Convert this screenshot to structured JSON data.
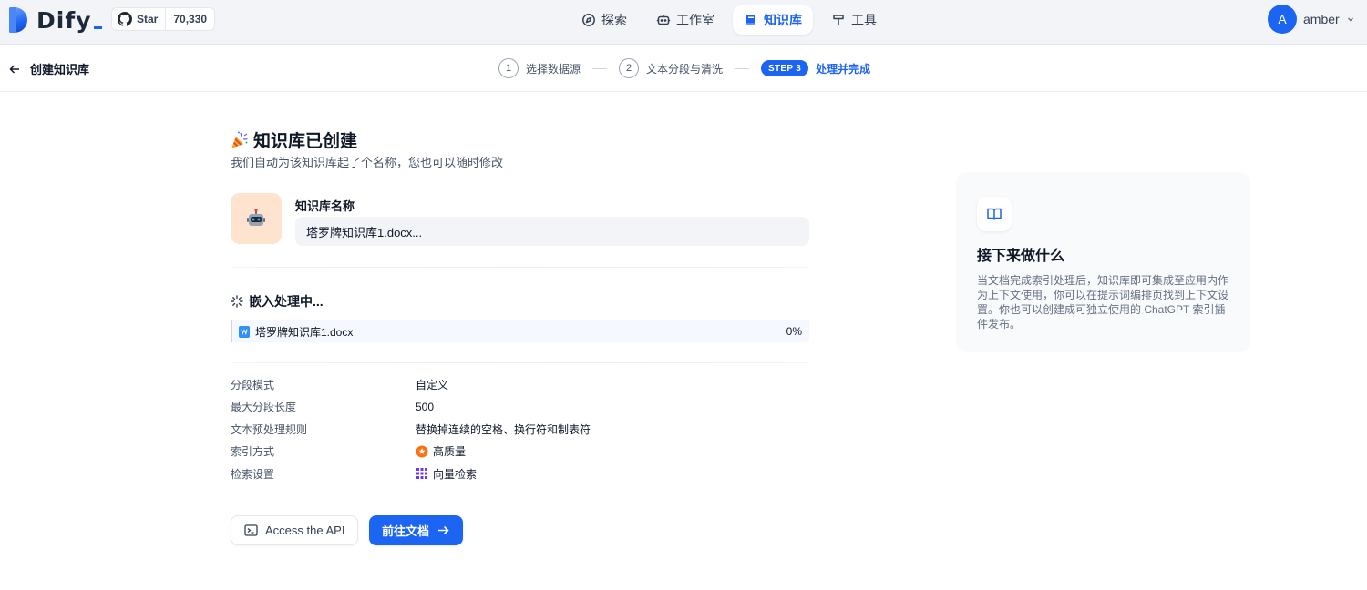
{
  "app": {
    "logo_text": "Dify"
  },
  "github": {
    "star_label": "Star",
    "star_count": "70,330"
  },
  "nav": {
    "items": [
      {
        "label": "探索",
        "icon": "compass-icon",
        "active": false
      },
      {
        "label": "工作室",
        "icon": "robot-icon",
        "active": false
      },
      {
        "label": "知识库",
        "icon": "book-icon",
        "active": true
      },
      {
        "label": "工具",
        "icon": "hammer-icon",
        "active": false
      }
    ]
  },
  "user": {
    "initial": "A",
    "name": "amber"
  },
  "subheader": {
    "back_label": "创建知识库",
    "steps": [
      {
        "num": "1",
        "label": "选择数据源"
      },
      {
        "num": "2",
        "label": "文本分段与清洗"
      },
      {
        "num": "STEP 3",
        "label": "处理并完成"
      }
    ]
  },
  "main": {
    "title": "知识库已创建",
    "subtitle": "我们自动为该知识库起了个名称，您也可以随时修改",
    "kb_name_label": "知识库名称",
    "kb_name_value": "塔罗牌知识库1.docx...",
    "embedding_status": "嵌入处理中...",
    "file": {
      "name": "塔罗牌知识库1.docx",
      "progress": "0%"
    },
    "info": [
      {
        "label": "分段模式",
        "value": "自定义",
        "icon": ""
      },
      {
        "label": "最大分段长度",
        "value": "500",
        "icon": ""
      },
      {
        "label": "文本预处理规则",
        "value": "替换掉连续的空格、换行符和制表符",
        "icon": ""
      },
      {
        "label": "索引方式",
        "value": "高质量",
        "icon": "star-badge-icon"
      },
      {
        "label": "检索设置",
        "value": "向量检索",
        "icon": "grid-icon"
      }
    ],
    "api_button": "Access the API",
    "docs_button": "前往文档"
  },
  "side_card": {
    "title": "接下来做什么",
    "text": "当文档完成索引处理后，知识库即可集成至应用内作为上下文使用，你可以在提示词编排页找到上下文设置。你也可以创建成可独立使用的 ChatGPT 索引插件发布。"
  },
  "colors": {
    "accent": "#1c64f2",
    "header_bg": "#f2f4f7",
    "kb_icon_bg": "#fee4cf"
  }
}
